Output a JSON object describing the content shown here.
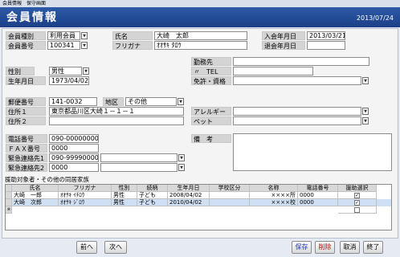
{
  "window": {
    "title": "会員情報　保守画面"
  },
  "header": {
    "title": "会員情報",
    "date": "2013/07/24"
  },
  "labels": {
    "member_type": "会員種別",
    "member_no": "会員番号",
    "name": "氏名",
    "furigana": "フリガナ",
    "join_date": "入会年月日",
    "leave_date": "退会年月日",
    "gender": "性別",
    "workplace": "勤務先",
    "tel_short": "〃　TEL",
    "birthdate": "生年月日",
    "license": "免許・資格",
    "postal": "郵便番号",
    "area": "地区",
    "address1": "住所１",
    "address2": "住所２",
    "allergy": "アレルギー",
    "pet": "ペット",
    "phone": "電話番号",
    "fax": "ＦＡＸ番号",
    "emerg1": "緊急連絡先1",
    "emerg2": "緊急連絡先2",
    "remarks": "備　考",
    "family_section": "援助対象者・その他の同居家族"
  },
  "values": {
    "member_type": "利用会員",
    "member_no": "100341",
    "name": "大崎　太郎",
    "furigana": "ｵｵｻｷ ﾀﾛｳ",
    "join_date": "2013/03/21",
    "leave_date": "",
    "gender": "男性",
    "workplace": "",
    "tel": "",
    "birthdate": "1973/04/02",
    "license": "",
    "postal": "141-0032",
    "area": "その他",
    "address1": "東京都品川区大崎１－１－１",
    "address2": "",
    "allergy": "",
    "pet": "",
    "phone": "090-00000000",
    "fax": "0000",
    "emerg1": "090-99990000",
    "emerg1_rel": "",
    "emerg2": "0000",
    "emerg2_rel": ""
  },
  "grid": {
    "headers": [
      "氏名",
      "フリガナ",
      "性別",
      "続柄",
      "生年月日",
      "学校区分",
      "名称",
      "電話番号",
      "援助選択"
    ],
    "rows": [
      {
        "name": "大崎　一郎",
        "kana": "ｵｵｻｷ ｲﾁﾛｳ",
        "gender": "男性",
        "rel": "子ども",
        "birth": "2008/04/02",
        "school": "",
        "org": "××××所",
        "tel": "0000",
        "checked": "✓"
      },
      {
        "name": "大崎　次郎",
        "kana": "ｵｵｻｷ ｼﾞﾛｳ",
        "gender": "男性",
        "rel": "子ども",
        "birth": "2010/04/02",
        "school": "",
        "org": "××××校",
        "tel": "0000",
        "checked": "✓"
      }
    ],
    "new_row_marker": "＊"
  },
  "buttons": {
    "prev": "前へ",
    "next": "次へ",
    "save": "保存",
    "delete": "削除",
    "cancel": "取消",
    "close": "終了"
  },
  "colors": {
    "header_bg": "#1c3f86",
    "save_text": "#1a2fb0",
    "delete_text": "#c00000"
  }
}
